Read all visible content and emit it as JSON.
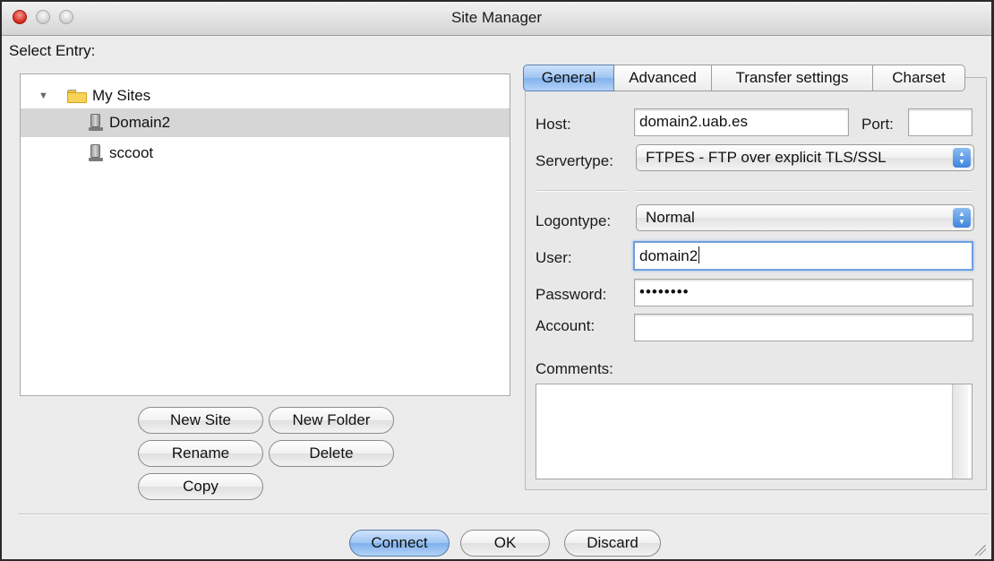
{
  "window": {
    "title": "Site Manager"
  },
  "select_entry_label": "Select Entry:",
  "tree": {
    "folder": {
      "label": "My Sites",
      "expanded": true
    },
    "sites": [
      {
        "label": "Domain2",
        "selected": true
      },
      {
        "label": "sccoot",
        "selected": false
      }
    ]
  },
  "left_buttons": {
    "new_site": "New Site",
    "new_folder": "New Folder",
    "rename": "Rename",
    "delete": "Delete",
    "copy": "Copy"
  },
  "tabs": [
    {
      "label": "General",
      "active": true
    },
    {
      "label": "Advanced",
      "active": false
    },
    {
      "label": "Transfer settings",
      "active": false
    },
    {
      "label": "Charset",
      "active": false
    }
  ],
  "general": {
    "host_label": "Host:",
    "host_value": "domain2.uab.es",
    "port_label": "Port:",
    "port_value": "",
    "servertype_label": "Servertype:",
    "servertype_value": "FTPES - FTP over explicit TLS/SSL",
    "logontype_label": "Logontype:",
    "logontype_value": "Normal",
    "user_label": "User:",
    "user_value": "domain2",
    "password_label": "Password:",
    "password_value": "••••••••",
    "account_label": "Account:",
    "account_value": "",
    "comments_label": "Comments:",
    "comments_value": ""
  },
  "footer": {
    "connect": "Connect",
    "ok": "OK",
    "discard": "Discard"
  },
  "colors": {
    "accent": "#81b2ec",
    "selection": "#d6d6d6",
    "close_button": "#d3261a"
  }
}
